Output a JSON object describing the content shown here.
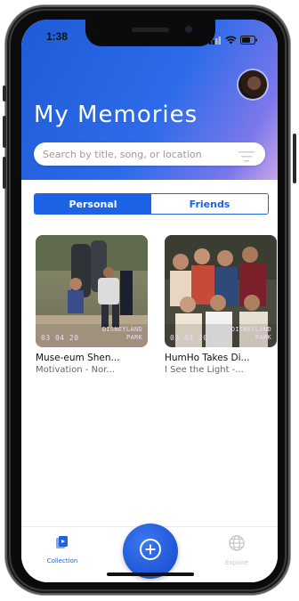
{
  "status_bar": {
    "time": "1:38"
  },
  "header": {
    "title": "My Memories",
    "search_placeholder": "Search by title, song, or location"
  },
  "tabs": [
    {
      "label": "Personal",
      "active": true
    },
    {
      "label": "Friends",
      "active": false
    }
  ],
  "memories": [
    {
      "date": "03 04 20",
      "place_line1": "DISNEYLAND",
      "place_line2": "PARK",
      "title": "Muse-eum Shen...",
      "song": "Motivation - Nor..."
    },
    {
      "date": "03 03 20",
      "place_line1": "DISNEYLAND",
      "place_line2": "PARK",
      "title": "HumHo Takes Di...",
      "song": "I See the Light -..."
    }
  ],
  "bottom_nav": {
    "collection_label": "Collection",
    "explore_label": "Explore",
    "add_icon": "plus-circle-icon"
  },
  "colors": {
    "accent": "#1e63e6",
    "header_gradient_start": "#1f5bd6",
    "header_gradient_end": "#c7a4ea",
    "inactive_nav": "#c8c8c8"
  }
}
